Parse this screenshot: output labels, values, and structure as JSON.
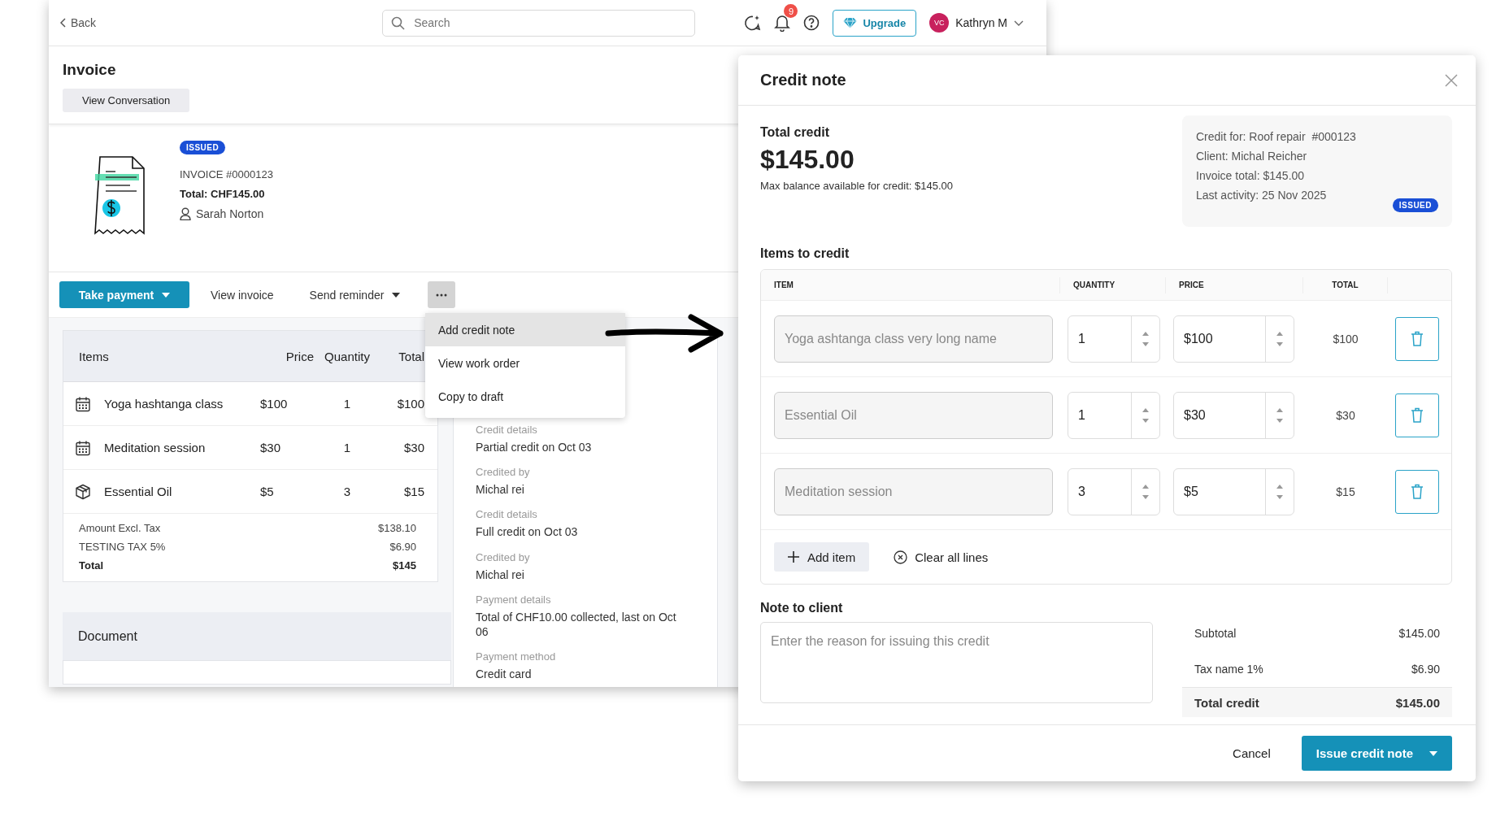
{
  "back_window": {
    "top_bar": {
      "back_label": "Back",
      "search": {
        "placeholder": "Search"
      },
      "notification_count": "9",
      "upgrade_label": "Upgrade",
      "user": {
        "initials": "VC",
        "name": "Kathryn M"
      }
    },
    "page_title": "Invoice",
    "view_conversation": "View Conversation",
    "invoice": {
      "status": "ISSUED",
      "number": "INVOICE #0000123",
      "total": "Total: CHF145.00",
      "client": "Sarah Norton"
    },
    "actions": [
      {
        "kind": "primary",
        "label": "Take payment"
      },
      {
        "kind": "link",
        "label": "View invoice"
      },
      {
        "kind": "dropdown",
        "label": "Send reminder"
      },
      {
        "kind": "more",
        "expanded": true
      }
    ],
    "more_menu": [
      {
        "label": "Add credit note",
        "selected": true
      },
      {
        "label": "View work order",
        "selected": false
      },
      {
        "label": "Copy to draft",
        "selected": false
      }
    ],
    "items_table": {
      "columns": [
        "Items",
        "Price",
        "Quantity",
        "Total"
      ],
      "rows": [
        {
          "kind": "service",
          "name": "Yoga hashtanga class",
          "price": "$100",
          "quantity": "1",
          "total": "$100"
        },
        {
          "kind": "service",
          "name": "Meditation session",
          "price": "$30",
          "quantity": "1",
          "total": "$30"
        },
        {
          "kind": "product",
          "name": "Essential Oil",
          "price": "$5",
          "quantity": "3",
          "total": "$15"
        }
      ]
    },
    "totals": [
      {
        "label": "Amount Excl. Tax",
        "value": "$138.10",
        "bold": false
      },
      {
        "label": "TESTING TAX 5%",
        "value": "$6.90",
        "bold": false
      },
      {
        "label": "Total",
        "value": "$145",
        "bold": true
      }
    ],
    "document_title": "Document",
    "details": [
      {
        "label": "Credit details",
        "value": "Partial credit on Oct 03"
      },
      {
        "label": "Credited by",
        "value": "Michal rei"
      },
      {
        "label": "Credit details",
        "value": "Full credit on Oct 03"
      },
      {
        "label": "Credited by",
        "value": "Michal rei"
      },
      {
        "label": "Payment details",
        "value": "Total of CHF10.00 collected, last on Oct 06"
      },
      {
        "label": "Payment method",
        "value": "Credit card"
      }
    ]
  },
  "credit_note": {
    "title": "Credit note",
    "total_label": "Total credit",
    "total_amount": "$145.00",
    "max_balance": "Max balance available for credit: $145.00",
    "info": {
      "lines": [
        "Credit for: Roof repair  #000123",
        "Client: Michal Reicher",
        "Invoice total: $145.00",
        "Last activity: 25 Nov 2025"
      ],
      "status": "ISSUED"
    },
    "items_heading": "Items to credit",
    "columns": [
      "ITEM",
      "QUANTITY",
      "PRICE",
      "TOTAL"
    ],
    "lines": [
      {
        "item": {
          "placeholder": "Yoga ashtanga class very long name"
        },
        "quantity": "1",
        "price": "$100",
        "total": "$100"
      },
      {
        "item": {
          "placeholder": "Essential Oil"
        },
        "quantity": "1",
        "price": "$30",
        "total": "$30"
      },
      {
        "item": {
          "placeholder": "Meditation session"
        },
        "quantity": "3",
        "price": "$5",
        "total": "$15"
      }
    ],
    "add_item": "Add item",
    "clear_lines": "Clear all lines",
    "note_heading": "Note to client",
    "note": {
      "placeholder": "Enter the reason for issuing this credit"
    },
    "summary": [
      {
        "kind": "line",
        "label": "Subtotal",
        "value": "$145.00"
      },
      {
        "kind": "line",
        "label": "Tax name 1%",
        "value": "$6.90"
      },
      {
        "kind": "total",
        "label": "Total credit",
        "value": "$145.00"
      }
    ],
    "footer": {
      "cancel": "Cancel",
      "submit": "Issue credit note"
    }
  }
}
